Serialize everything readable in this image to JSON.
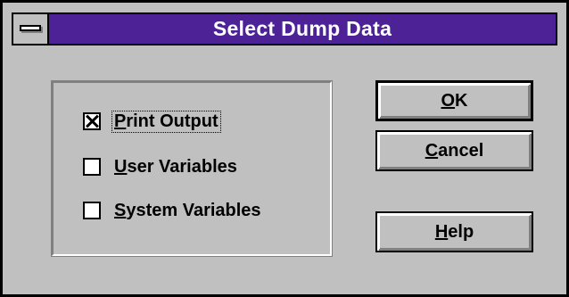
{
  "window": {
    "title": "Select Dump Data"
  },
  "options": [
    {
      "label_mnemonic": "P",
      "label_rest": "rint Output",
      "checked": true
    },
    {
      "label_mnemonic": "U",
      "label_rest": "ser Variables",
      "checked": false
    },
    {
      "label_mnemonic": "S",
      "label_rest": "ystem Variables",
      "checked": false
    }
  ],
  "buttons": {
    "ok": {
      "mnemonic": "O",
      "rest": "K"
    },
    "cancel": {
      "mnemonic": "C",
      "rest": "ancel"
    },
    "help": {
      "mnemonic": "H",
      "rest": "elp"
    }
  },
  "icons": {
    "system_menu": "system-menu-icon",
    "checkbox": "checkbox-icon"
  },
  "colors": {
    "titlebar": "#4c2296",
    "face": "#c0c0c0"
  }
}
